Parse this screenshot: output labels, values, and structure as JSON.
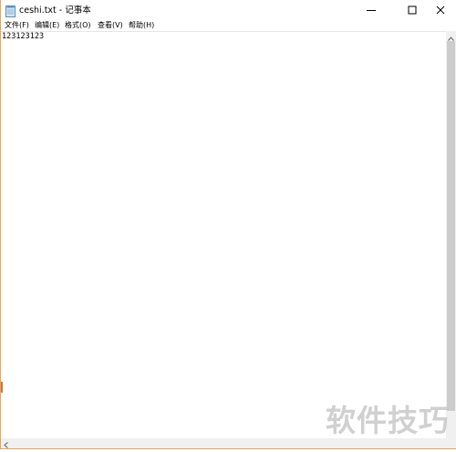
{
  "window": {
    "title": "ceshi.txt - 记事本"
  },
  "menu": {
    "items": [
      "文件(F)",
      "编辑(E)",
      "格式(O)",
      "查看(V)",
      "帮助(H)"
    ]
  },
  "editor": {
    "content": "123123123"
  },
  "watermark": {
    "text": "软件技巧"
  },
  "icons": {
    "app": "notepad-icon",
    "minimize": "minimize-icon",
    "maximize": "maximize-icon",
    "close": "close-icon",
    "scroll_up": "arrow-up-icon",
    "scroll_left": "arrow-left-icon"
  }
}
